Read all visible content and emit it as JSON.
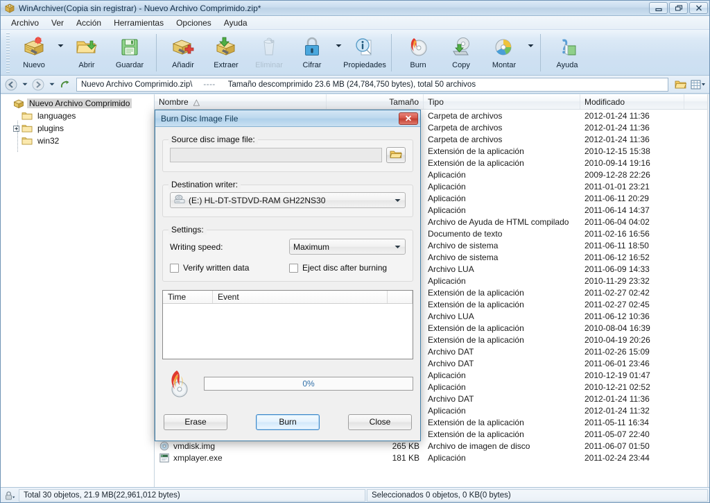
{
  "window": {
    "title": "WinArchiver(Copia sin registrar) - Nuevo Archivo Comprimido.zip*",
    "icon": "archive-icon",
    "minimize_label": "Minimizar",
    "restore_label": "Restaurar",
    "close_label": "Cerrar"
  },
  "menu": {
    "items": [
      {
        "label": "Archivo"
      },
      {
        "label": "Ver"
      },
      {
        "label": "Acción"
      },
      {
        "label": "Herramientas"
      },
      {
        "label": "Opciones"
      },
      {
        "label": "Ayuda"
      }
    ]
  },
  "toolbar": {
    "groups": [
      {
        "buttons": [
          {
            "label": "Nuevo",
            "icon": "new-archive-icon",
            "disabled": false,
            "dropdown": true
          },
          {
            "label": "Abrir",
            "icon": "open-folder-icon",
            "disabled": false,
            "dropdown": false
          },
          {
            "label": "Guardar",
            "icon": "save-floppy-icon",
            "disabled": false,
            "dropdown": false
          }
        ]
      },
      {
        "buttons": [
          {
            "label": "Añadir",
            "icon": "add-archive-icon",
            "disabled": false,
            "dropdown": false
          },
          {
            "label": "Extraer",
            "icon": "extract-archive-icon",
            "disabled": false,
            "dropdown": false
          },
          {
            "label": "Eliminar",
            "icon": "delete-trash-icon",
            "disabled": true,
            "dropdown": false
          },
          {
            "label": "Cifrar",
            "icon": "lock-icon",
            "disabled": false,
            "dropdown": true
          },
          {
            "label": "Propiedades",
            "icon": "info-properties-icon",
            "disabled": false,
            "dropdown": false
          }
        ]
      },
      {
        "buttons": [
          {
            "label": "Burn",
            "icon": "burn-disc-icon",
            "disabled": false,
            "dropdown": false
          },
          {
            "label": "Copy",
            "icon": "copy-disc-icon",
            "disabled": false,
            "dropdown": false
          },
          {
            "label": "Montar",
            "icon": "mount-disc-icon",
            "disabled": false,
            "dropdown": true
          }
        ]
      },
      {
        "buttons": [
          {
            "label": "Ayuda",
            "icon": "help-question-icon",
            "disabled": false,
            "dropdown": false
          }
        ]
      }
    ]
  },
  "addressbar": {
    "back_label": "Atrás",
    "forward_label": "Adelante",
    "up_label": "Arriba",
    "path": "Nuevo Archivo Comprimido.zip\\",
    "separator": "----",
    "info": "Tamaño descomprimido 23.6 MB (24,784,750 bytes), total 50 archivos",
    "right_buttons": [
      {
        "icon": "open-folder-small-icon",
        "label": "Abrir carpeta"
      },
      {
        "icon": "view-mode-icon",
        "label": "Vista"
      }
    ]
  },
  "tree": {
    "root": {
      "label": "Nuevo Archivo Comprimido",
      "icon": "archive-icon",
      "selected": true
    },
    "children": [
      {
        "label": "languages",
        "icon": "folder-icon",
        "expandable": false
      },
      {
        "label": "plugins",
        "icon": "folder-icon",
        "expandable": true
      },
      {
        "label": "win32",
        "icon": "folder-icon",
        "expandable": false
      }
    ]
  },
  "filelist": {
    "columns": [
      {
        "key": "name",
        "label": "Nombre",
        "sorted": "asc"
      },
      {
        "key": "size",
        "label": "Tamaño"
      },
      {
        "key": "type",
        "label": "Tipo"
      },
      {
        "key": "modified",
        "label": "Modificado"
      }
    ],
    "sort_glyph": "△",
    "rows": [
      {
        "name": "",
        "size": "",
        "type": "Carpeta de archivos",
        "modified": "2012-01-24 11:36",
        "icon": "folder-icon",
        "selected": true
      },
      {
        "name": "",
        "size": "",
        "type": "Carpeta de archivos",
        "modified": "2012-01-24 11:36",
        "icon": "folder-icon"
      },
      {
        "name": "",
        "size": "",
        "type": "Carpeta de archivos",
        "modified": "2012-01-24 11:36",
        "icon": "folder-icon"
      },
      {
        "name": "",
        "size": "",
        "type": "Extensión de la aplicación",
        "modified": "2010-12-15 15:38",
        "icon": "dll-icon"
      },
      {
        "name": "",
        "size": "",
        "type": "Extensión de la aplicación",
        "modified": "2010-09-14 19:16",
        "icon": "dll-icon"
      },
      {
        "name": "",
        "size": "",
        "type": "Aplicación",
        "modified": "2009-12-28 22:26",
        "icon": "exe-icon"
      },
      {
        "name": "",
        "size": "",
        "type": "Aplicación",
        "modified": "2011-01-01 23:21",
        "icon": "exe-icon"
      },
      {
        "name": "",
        "size": "",
        "type": "Aplicación",
        "modified": "2011-06-11 20:29",
        "icon": "exe-icon"
      },
      {
        "name": "",
        "size": "",
        "type": "Aplicación",
        "modified": "2011-06-14 14:37",
        "icon": "exe-icon"
      },
      {
        "name": "",
        "size": "",
        "type": "Archivo de Ayuda de HTML compilado",
        "modified": "2011-06-04 04:02",
        "icon": "chm-icon"
      },
      {
        "name": "",
        "size": "",
        "type": "Documento de texto",
        "modified": "2011-02-16 16:56",
        "icon": "txt-icon"
      },
      {
        "name": "",
        "size": "",
        "type": "Archivo de sistema",
        "modified": "2011-06-11 18:50",
        "icon": "sys-icon"
      },
      {
        "name": "",
        "size": "",
        "type": "Archivo de sistema",
        "modified": "2011-06-12 16:52",
        "icon": "sys-icon"
      },
      {
        "name": "",
        "size": "",
        "type": "Archivo LUA",
        "modified": "2011-06-09 14:33",
        "icon": "lua-icon"
      },
      {
        "name": "",
        "size": "",
        "type": "Aplicación",
        "modified": "2010-11-29 23:32",
        "icon": "exe-icon"
      },
      {
        "name": "",
        "size": "",
        "type": "Extensión de la aplicación",
        "modified": "2011-02-27 02:42",
        "icon": "dll-icon"
      },
      {
        "name": "",
        "size": "",
        "type": "Extensión de la aplicación",
        "modified": "2011-02-27 02:45",
        "icon": "dll-icon"
      },
      {
        "name": "",
        "size": "",
        "type": "Archivo LUA",
        "modified": "2011-06-12 10:36",
        "icon": "lua-icon"
      },
      {
        "name": "",
        "size": "",
        "type": "Extensión de la aplicación",
        "modified": "2010-08-04 16:39",
        "icon": "dll-icon"
      },
      {
        "name": "",
        "size": "",
        "type": "Extensión de la aplicación",
        "modified": "2010-04-19 20:26",
        "icon": "dll-icon"
      },
      {
        "name": "",
        "size": "",
        "type": "Archivo DAT",
        "modified": "2011-02-26 15:09",
        "icon": "dat-icon"
      },
      {
        "name": "",
        "size": "",
        "type": "Archivo DAT",
        "modified": "2011-06-01 23:46",
        "icon": "dat-icon"
      },
      {
        "name": "",
        "size": "",
        "type": "Aplicación",
        "modified": "2010-12-19 01:47",
        "icon": "exe-icon"
      },
      {
        "name": "",
        "size": "",
        "type": "Aplicación",
        "modified": "2010-12-21 02:52",
        "icon": "exe-icon"
      },
      {
        "name": "",
        "size": "",
        "type": "Archivo DAT",
        "modified": "2012-01-24 11:36",
        "icon": "dat-icon"
      },
      {
        "name": "",
        "size": "",
        "type": "Aplicación",
        "modified": "2012-01-24 11:32",
        "icon": "exe-icon"
      },
      {
        "name": "",
        "size": "",
        "type": "Extensión de la aplicación",
        "modified": "2011-05-11 16:34",
        "icon": "dll-icon"
      },
      {
        "name": "",
        "size": "",
        "type": "Extensión de la aplicación",
        "modified": "2011-05-07 22:40",
        "icon": "dll-icon"
      },
      {
        "name": "vmdisk.img",
        "size": "265 KB",
        "type": "Archivo de imagen de disco",
        "modified": "2011-06-07 01:50",
        "icon": "disc-image-icon"
      },
      {
        "name": "xmplayer.exe",
        "size": "181 KB",
        "type": "Aplicación",
        "modified": "2011-02-24 23:44",
        "icon": "exe-icon"
      }
    ]
  },
  "statusbar": {
    "lock_icon": "lock-small-icon",
    "left": "Total 30 objetos, 21.9 MB(22,961,012 bytes)",
    "right": "Seleccionados 0 objetos, 0 KB(0 bytes)"
  },
  "dialog": {
    "title": "Burn Disc Image File",
    "close_label": "Cerrar",
    "source": {
      "legend": "Source disc image file:",
      "value": "",
      "placeholder": "",
      "browse_label": "Examinar",
      "browse_icon": "folder-open-icon"
    },
    "destination": {
      "legend": "Destination writer:",
      "value": "(E:) HL-DT-STDVD-RAM GH22NS30",
      "icon": "optical-drive-icon"
    },
    "settings": {
      "legend": "Settings:",
      "speed_label": "Writing speed:",
      "speed_value": "Maximum",
      "verify_label": "Verify written data",
      "verify_checked": false,
      "eject_label": "Eject disc after burning",
      "eject_checked": false
    },
    "log": {
      "columns": [
        "Time",
        "Event"
      ],
      "rows": []
    },
    "progress": {
      "icon": "burning-disc-icon",
      "percent_label": "0%",
      "percent_value": 0
    },
    "buttons": [
      {
        "label": "Erase",
        "name": "erase-button",
        "default": false
      },
      {
        "label": "Burn",
        "name": "burn-button",
        "default": true
      },
      {
        "label": "Close",
        "name": "close-button",
        "default": false
      }
    ]
  },
  "colors": {
    "accent": "#3c87c9",
    "title_text": "#16314b",
    "close_red": "#c13d30",
    "progress_text": "#2f6fa8"
  }
}
